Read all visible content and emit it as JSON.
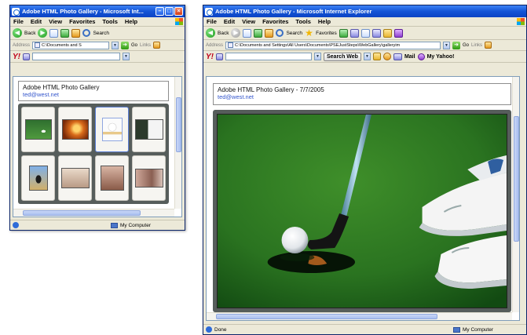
{
  "left_window": {
    "title": "Adobe HTML Photo Gallery - Microsoft Int...",
    "menu": [
      "File",
      "Edit",
      "View",
      "Favorites",
      "Tools",
      "Help"
    ],
    "toolbar": {
      "back_label": "Back",
      "search_label": "Search"
    },
    "address": {
      "label": "Address",
      "value": "C:\\Documents and S",
      "go_label": "Go",
      "links_label": "Links"
    },
    "gallery": {
      "title": "Adobe HTML Photo Gallery",
      "email": "ted@west.net"
    },
    "status": {
      "text": "",
      "zone": "My Computer"
    }
  },
  "right_window": {
    "title": "Adobe HTML Photo Gallery - Microsoft Internet Explorer",
    "menu": [
      "File",
      "Edit",
      "View",
      "Favorites",
      "Tools",
      "Help"
    ],
    "toolbar": {
      "back_label": "Back",
      "search_label": "Search",
      "favorites_label": "Favorites"
    },
    "address": {
      "label": "Address",
      "value": "C:\\Documents and Settings\\All Users\\Documents\\PSEJustSteps\\WebGallery\\galleryim",
      "go_label": "Go",
      "links_label": "Links"
    },
    "yahoo": {
      "search_label": "Search Web",
      "mail_label": "Mail",
      "my_yahoo_label": "My Yahoo!"
    },
    "gallery": {
      "title": "Adobe HTML Photo Gallery - 7/7/2005",
      "email": "ted@west.net"
    },
    "status": {
      "text": "Done",
      "zone": "My Computer"
    }
  }
}
